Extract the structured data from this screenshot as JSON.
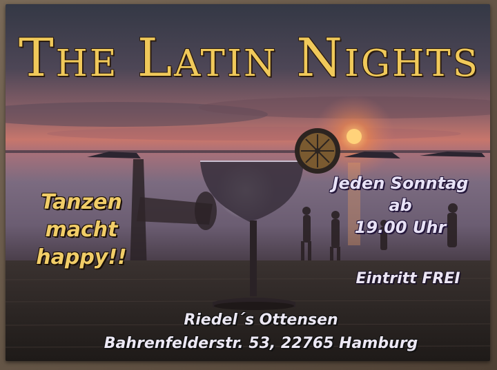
{
  "flyer": {
    "title": "The Latin Nights",
    "slogan_lines": [
      "Tanzen",
      "macht",
      "happy!!"
    ],
    "schedule_lines": [
      "Jeden Sonntag",
      "ab",
      "19.00 Uhr"
    ],
    "entry": "Eintritt FREI",
    "venue_name": "Riedel´s Ottensen",
    "venue_address": "Bahrenfelderstr. 53, 22765 Hamburg"
  },
  "colors": {
    "title": "#f0c95a",
    "slogan": "#f1cd68",
    "info_text": "#ece6f4",
    "sky_top": "#3c3f4c",
    "sunset_glow": "#d97a55",
    "sea": "#7d6a72"
  },
  "icons": [
    "cocktail-glass-icon",
    "lime-slice-icon",
    "sun-icon"
  ]
}
